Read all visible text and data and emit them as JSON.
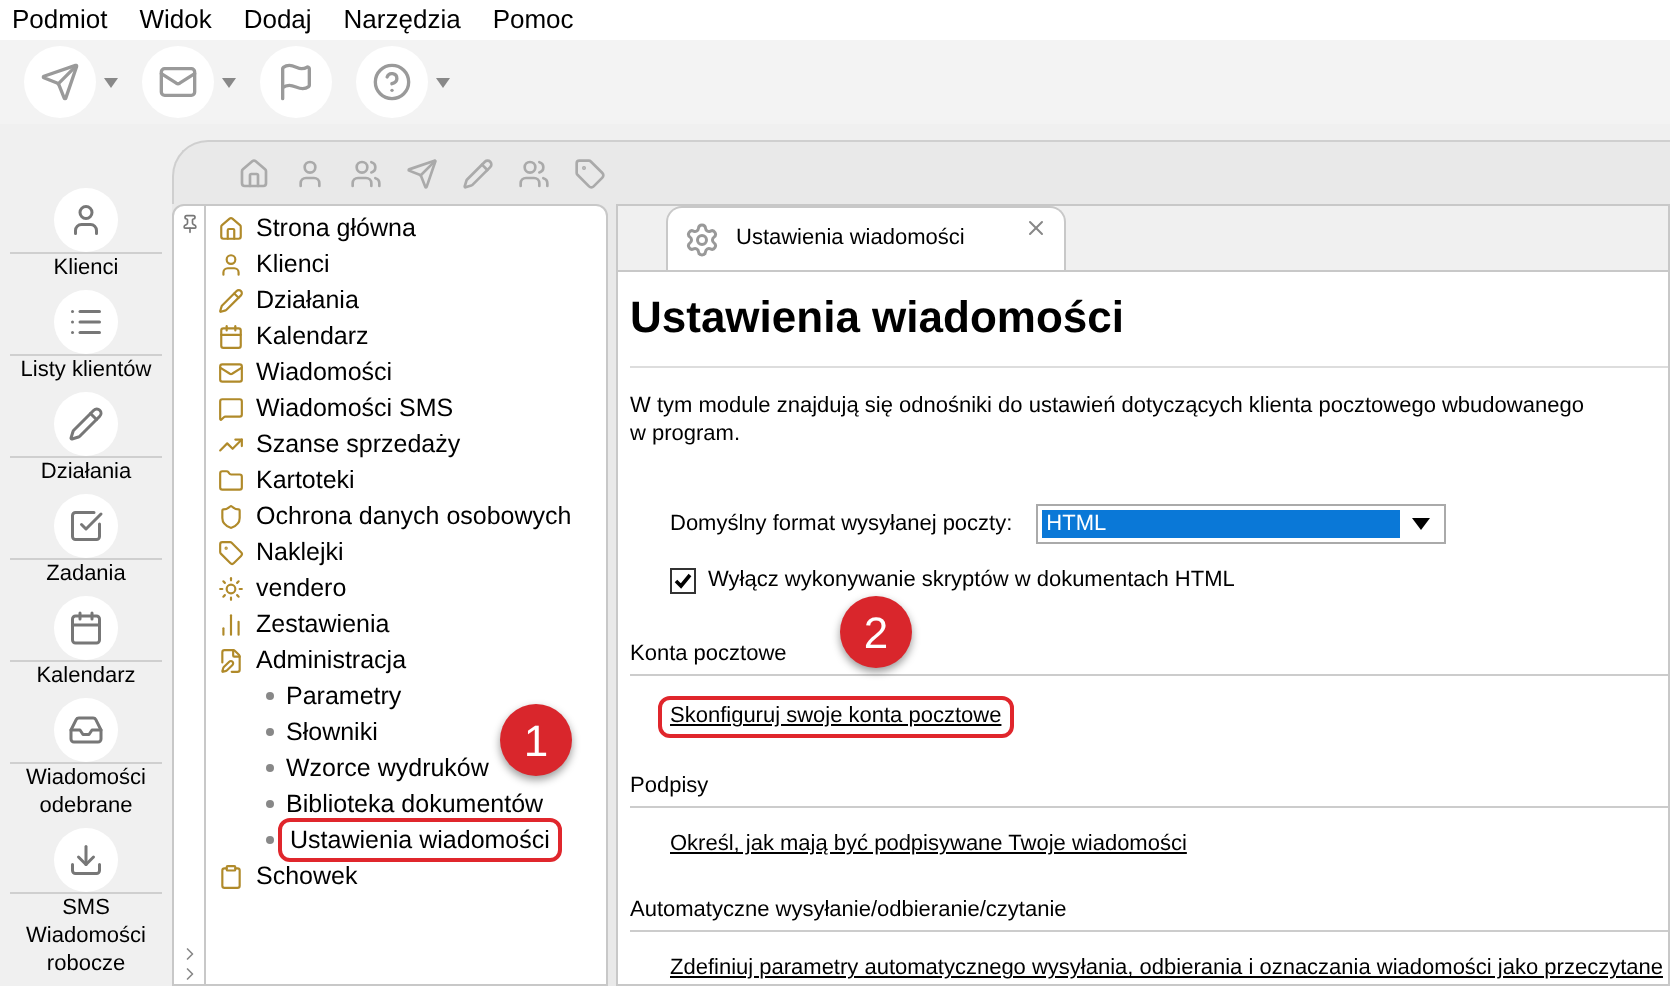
{
  "menu": [
    "Podmiot",
    "Widok",
    "Dodaj",
    "Narzędzia",
    "Pomoc"
  ],
  "nav": [
    {
      "label": "Klienci"
    },
    {
      "label": "Listy klientów"
    },
    {
      "label": "Działania"
    },
    {
      "label": "Zadania"
    },
    {
      "label": "Kalendarz"
    },
    {
      "label": "Wiadomości odebrane"
    },
    {
      "label": "SMS Wiadomości robocze"
    }
  ],
  "tree": [
    {
      "label": "Strona główna",
      "selected": false
    },
    {
      "label": "Klienci",
      "selected": false
    },
    {
      "label": "Działania",
      "selected": false
    },
    {
      "label": "Kalendarz",
      "selected": false
    },
    {
      "label": "Wiadomości",
      "selected": false
    },
    {
      "label": "Wiadomości SMS",
      "selected": false
    },
    {
      "label": "Szanse sprzedaży",
      "selected": false
    },
    {
      "label": "Kartoteki",
      "selected": false
    },
    {
      "label": "Ochrona danych osobowych",
      "selected": false
    },
    {
      "label": "Naklejki",
      "selected": false
    },
    {
      "label": "vendero",
      "selected": false
    },
    {
      "label": "Zestawienia",
      "selected": false
    },
    {
      "label": "Administracja",
      "selected": false,
      "children": [
        {
          "label": "Parametry",
          "selected": false
        },
        {
          "label": "Słowniki",
          "selected": false
        },
        {
          "label": "Wzorce wydruków",
          "selected": false
        },
        {
          "label": "Biblioteka dokumentów",
          "selected": false
        },
        {
          "label": "Ustawienia wiadomości",
          "selected": true
        }
      ]
    },
    {
      "label": "Schowek",
      "selected": false
    }
  ],
  "tab": {
    "label": "Ustawienia wiadomości",
    "selected": true
  },
  "page": {
    "title": "Ustawienia wiadomości",
    "intro": "W tym module znajdują się odnośniki do ustawień dotyczących klienta pocztowego wbudowanego w program.",
    "format_label": "Domyślny format wysyłanej poczty:",
    "format_value": "HTML",
    "checkbox": {
      "label": "Wyłącz wykonywanie skryptów w dokumentach HTML",
      "checked": true
    }
  },
  "sections": [
    {
      "heading": "Konta pocztowe",
      "link": "Skonfiguruj swoje konta pocztowe",
      "highlighted": true
    },
    {
      "heading": "Podpisy",
      "link": "Określ, jak mają być podpisywane Twoje wiadomości",
      "highlighted": false
    },
    {
      "heading": "Automatyczne wysyłanie/odbieranie/czytanie",
      "link": "Zdefiniuj parametry automatycznego wysyłania, odbierania i oznaczania wiadomości jako przeczytane",
      "highlighted": false
    }
  ],
  "callouts": [
    {
      "number": "1"
    },
    {
      "number": "2"
    }
  ]
}
